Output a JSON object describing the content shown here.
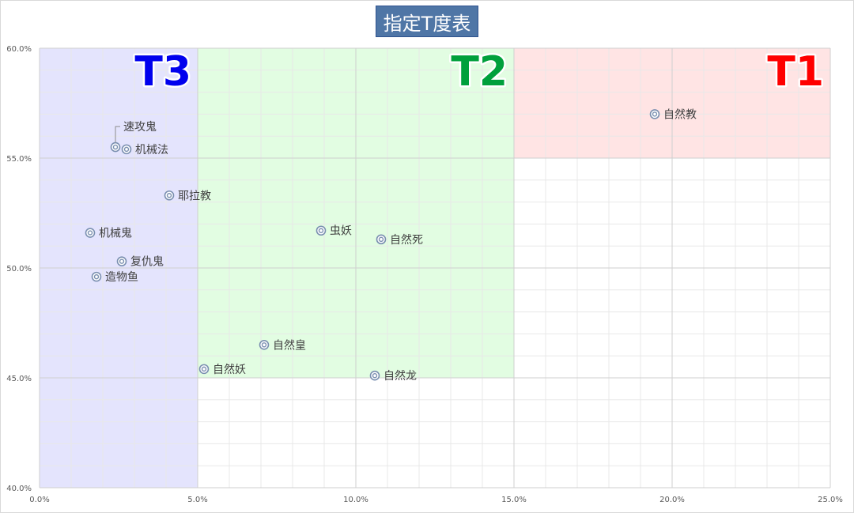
{
  "chart_data": {
    "type": "scatter",
    "title": "指定T度表",
    "xlabel": "",
    "ylabel": "",
    "xlim": [
      0.0,
      25.0
    ],
    "ylim": [
      40.0,
      60.0
    ],
    "x_ticks": [
      "0.0%",
      "5.0%",
      "10.0%",
      "15.0%",
      "20.0%",
      "25.0%"
    ],
    "y_ticks": [
      "40.0%",
      "45.0%",
      "50.0%",
      "55.0%",
      "60.0%"
    ],
    "x_tick_values": [
      0,
      5,
      10,
      15,
      20,
      25
    ],
    "y_tick_values": [
      40,
      45,
      50,
      55,
      60
    ],
    "grid": true,
    "points": [
      {
        "label": "速攻鬼",
        "x": 2.4,
        "y": 55.5
      },
      {
        "label": "机械法",
        "x": 2.75,
        "y": 55.4
      },
      {
        "label": "耶拉教",
        "x": 4.1,
        "y": 53.3
      },
      {
        "label": "机械鬼",
        "x": 1.6,
        "y": 51.6
      },
      {
        "label": "复仇鬼",
        "x": 2.6,
        "y": 50.3
      },
      {
        "label": "造物鱼",
        "x": 1.8,
        "y": 49.6
      },
      {
        "label": "虫妖",
        "x": 8.9,
        "y": 51.7
      },
      {
        "label": "自然死",
        "x": 10.8,
        "y": 51.3
      },
      {
        "label": "自然皇",
        "x": 7.1,
        "y": 46.5
      },
      {
        "label": "自然妖",
        "x": 5.2,
        "y": 45.4
      },
      {
        "label": "自然龙",
        "x": 10.6,
        "y": 45.1
      },
      {
        "label": "自然教",
        "x": 19.45,
        "y": 57.0
      }
    ],
    "tiers": [
      {
        "label": "T1",
        "color": "#ff0000",
        "fill": "#ffe4e4"
      },
      {
        "label": "T2",
        "color": "#00a03c",
        "fill": "#e2fde2"
      },
      {
        "label": "T3",
        "color": "#0000ee",
        "fill": "#e4e4fd"
      }
    ],
    "tier_regions": {
      "T1": [
        {
          "x": [
            15,
            25
          ],
          "y": [
            55,
            60
          ]
        }
      ],
      "T2": [
        {
          "x": [
            5,
            15
          ],
          "y": [
            45,
            60
          ]
        },
        {
          "x": [
            4,
            5
          ],
          "y": [
            52,
            55
          ]
        }
      ],
      "T3": [
        {
          "x": [
            0,
            5
          ],
          "y": [
            40,
            60
          ]
        }
      ]
    },
    "marker_color": "#7a8fb0"
  }
}
